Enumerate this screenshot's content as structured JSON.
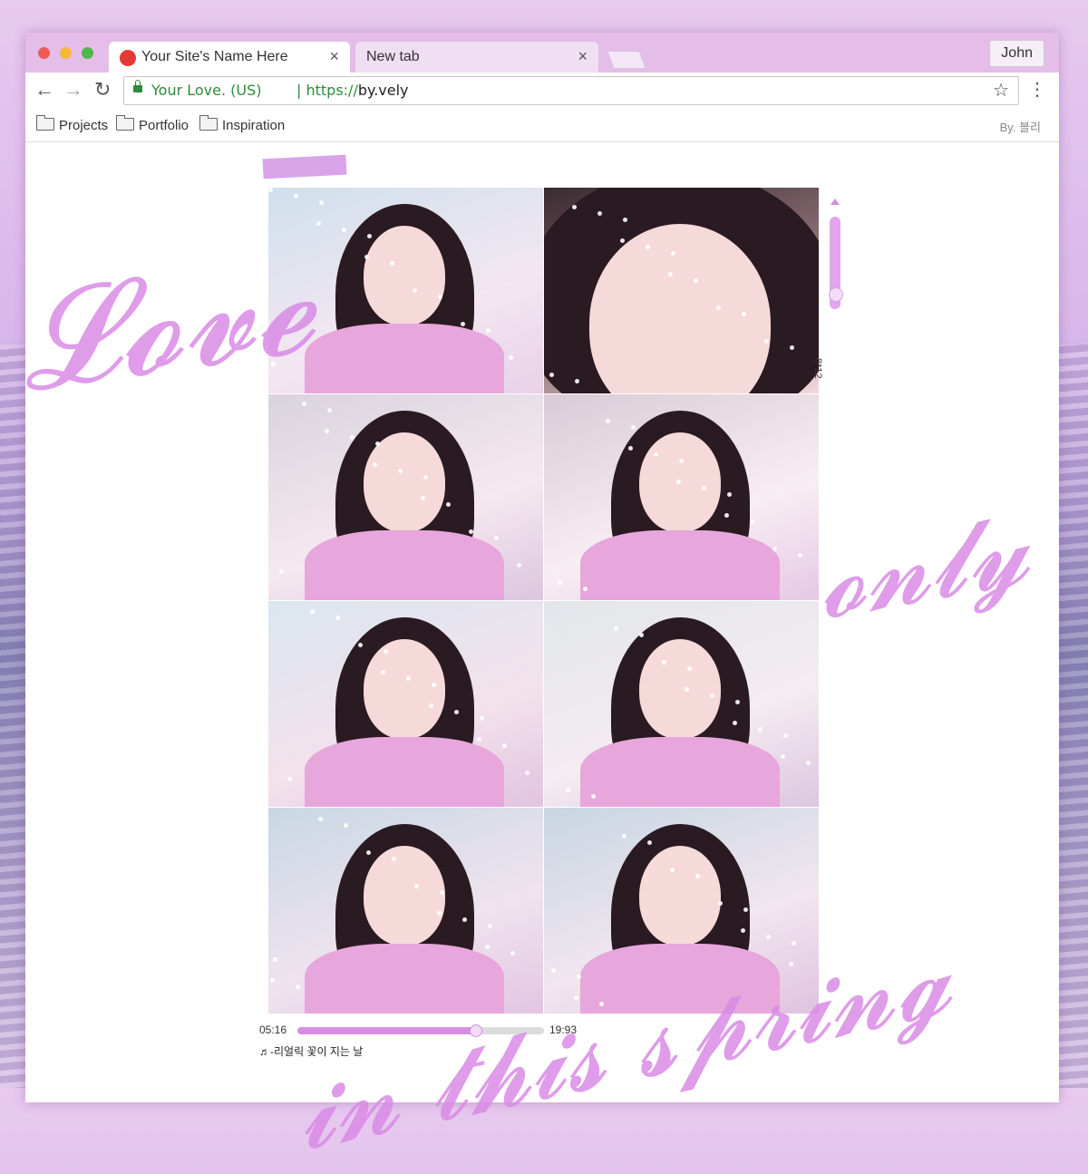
{
  "browser": {
    "tabs": [
      {
        "label": "Your Site's Name Here",
        "active": true
      },
      {
        "label": "New tab",
        "active": false
      }
    ],
    "user": "John",
    "address": {
      "secure_label": "Your Love. (US)",
      "separator": "|",
      "scheme": "https://",
      "host": "by.vely"
    },
    "bookmarks": [
      "Projects",
      "Portfolio",
      "Inspiration"
    ],
    "bookmarks_right": "By. 블리"
  },
  "gallery": {
    "photo_count": 8,
    "scroll_label": "8*12"
  },
  "player": {
    "elapsed": "05:16",
    "total": "19:93",
    "progress": 0.72,
    "song": "♬-리얼릭 꽃이 지는 날"
  },
  "colors": {
    "accent": "#d68ee3",
    "titlebar": "#e4bde9",
    "secure": "#2e8b3a"
  },
  "icons": [
    "close-dot",
    "minimize-dot",
    "maximize-dot",
    "favicon",
    "back-arrow-icon",
    "forward-arrow-icon",
    "reload-icon",
    "lock-icon",
    "star-icon",
    "menu-icon",
    "folder-icon"
  ]
}
